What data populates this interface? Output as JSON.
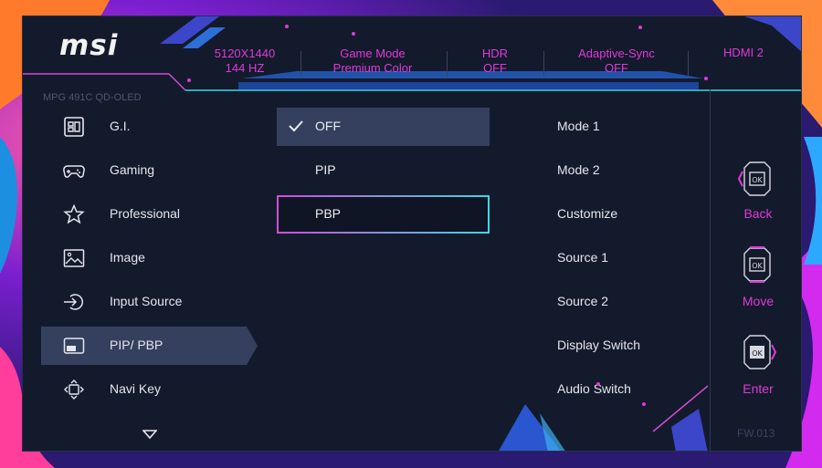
{
  "brand": {
    "logo": "msi",
    "model": "MPG 491C QD-OLED"
  },
  "status": [
    {
      "line1": "5120X1440",
      "line2": "144 HZ"
    },
    {
      "line1": "Game Mode",
      "line2": "Premium Color"
    },
    {
      "line1": "HDR",
      "line2": "OFF"
    },
    {
      "line1": "Adaptive-Sync",
      "line2": "OFF"
    },
    {
      "line1": "HDMI 2",
      "line2": ""
    }
  ],
  "sidebar": {
    "items": [
      {
        "label": "G.I.",
        "icon": "gi-icon"
      },
      {
        "label": "Gaming",
        "icon": "gamepad-icon"
      },
      {
        "label": "Professional",
        "icon": "star-icon"
      },
      {
        "label": "Image",
        "icon": "image-icon"
      },
      {
        "label": "Input Source",
        "icon": "input-source-icon"
      },
      {
        "label": "PIP/ PBP",
        "icon": "pip-icon",
        "selected": true
      },
      {
        "label": "Navi Key",
        "icon": "navi-key-icon"
      }
    ]
  },
  "options": [
    {
      "label": "OFF",
      "state": "current"
    },
    {
      "label": "PIP",
      "state": "normal"
    },
    {
      "label": "PBP",
      "state": "focused"
    }
  ],
  "submenu": [
    "Mode 1",
    "Mode 2",
    "Customize",
    "Source 1",
    "Source 2",
    "Display Switch",
    "Audio Switch"
  ],
  "keys": [
    {
      "label": "Back",
      "icon": "back-key-icon"
    },
    {
      "label": "Move",
      "icon": "move-key-icon"
    },
    {
      "label": "Enter",
      "icon": "enter-key-icon"
    }
  ],
  "firmware": "FW.013",
  "colors": {
    "accent": "#e03ad8",
    "cyan": "#3fd6e6",
    "panel": "#131a2c",
    "selected": "#34405e"
  }
}
